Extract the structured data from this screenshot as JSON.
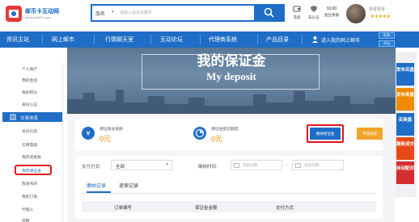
{
  "header": {
    "logo_title": "邮币卡互动网",
    "logo_url": "www.yb6001.com",
    "search_category": "品名",
    "search_placeholder": "请输入品名关键字",
    "user_items": [
      {
        "label": "充值",
        "icon": "wallet-icon"
      },
      {
        "label": "未认证",
        "icon": "shield-icon"
      },
      {
        "label": "金豆余额",
        "value": "9130",
        "icon": "coin-icon"
      }
    ],
    "username": "零零零零",
    "stars": "★★★★★"
  },
  "nav": {
    "items": [
      "资讯主站",
      "网上邮市",
      "行情聊天室",
      "互动论坛",
      "代理商系统",
      "产品目录"
    ],
    "my_mall": "进入我的网上邮市",
    "btn_top": "旺角",
    "btn_bottom": "开店"
  },
  "hero": {
    "title_cn": "我的保证金",
    "title_en": "My deposit"
  },
  "sidebar": {
    "items_top": [
      "个人账户",
      "我的金豆",
      "我的积分",
      "身份认证"
    ],
    "section_head": "交易信息",
    "items_bottom": [
      "会员信息",
      "信用等级",
      "我的资金账",
      "我的保证金",
      "我发布的",
      "我的订单",
      "代理人",
      "提醒"
    ]
  },
  "deposit": {
    "total_label": "保证金总金额",
    "total_value": "0元",
    "frozen_label": "保证金授信额度",
    "frozen_value": "0元",
    "pay_button": "缴纳保证金",
    "refund_button": "申请退保"
  },
  "filter": {
    "method_label": "支付方式:",
    "method_value": "全部",
    "time_label": "缴纳时间:",
    "start_placeholder": "开始日期",
    "end_placeholder": "结束日期",
    "dash": "-"
  },
  "tabs": [
    "缴纳记录",
    "退保记录"
  ],
  "table": {
    "columns": [
      "订单编号",
      "保证金金额",
      "支付方式"
    ]
  },
  "float_buttons": [
    {
      "label": "发布买盘",
      "color": "#1f6dc6"
    },
    {
      "label": "发布卖盘",
      "color": "#f08a00"
    },
    {
      "label": "买卖盘",
      "color": "#1f6dc6"
    },
    {
      "label": "最新成交",
      "color": "#e64a19"
    },
    {
      "label": "自动配对",
      "color": "#d32f2f"
    }
  ]
}
